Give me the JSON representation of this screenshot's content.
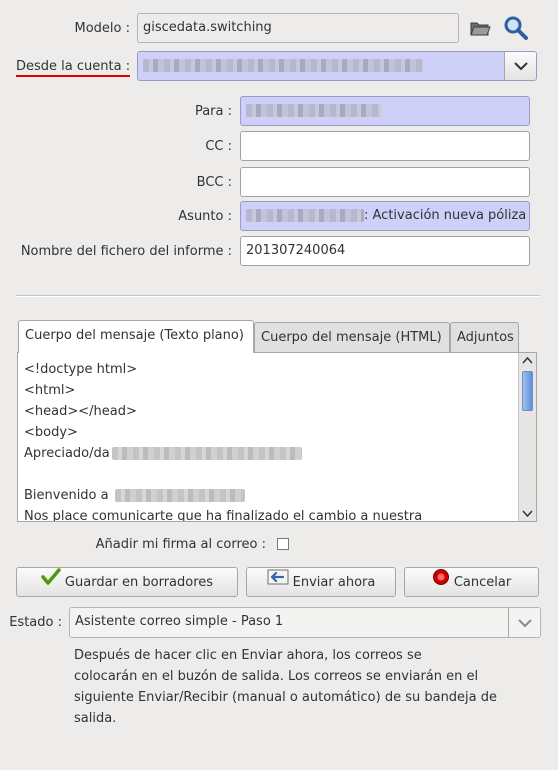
{
  "form": {
    "modelo_label": "Modelo :",
    "modelo_value": "giscedata.switching",
    "desde_label": "Desde la cuenta :",
    "para_label": "Para :",
    "cc_label": "CC :",
    "cc_value": "",
    "bcc_label": "BCC :",
    "bcc_value": "",
    "asunto_label": "Asunto :",
    "asunto_value": ": Activación nueva póliza",
    "fichero_label": "Nombre del fichero del informe :",
    "fichero_value": "201307240064"
  },
  "tabs": [
    {
      "label": "Cuerpo del mensaje (Texto plano)"
    },
    {
      "label": "Cuerpo del mensaje (HTML)"
    },
    {
      "label": "Adjuntos"
    }
  ],
  "body_lines": [
    "<!doctype html>",
    "<html>",
    "<head></head>",
    "<body>",
    "Apreciado/da",
    "",
    "Bienvenido a",
    "Nos place comunicarte que ha finalizado el cambio a nuestra"
  ],
  "signature": {
    "label": "Añadir mi firma al correo :",
    "checked": false
  },
  "buttons": {
    "save": "Guardar en borradores",
    "send": "Enviar ahora",
    "cancel": "Cancelar"
  },
  "estado": {
    "label": "Estado :",
    "value": "Asistente correo simple - Paso 1"
  },
  "help_text": [
    "Después de hacer clic en Enviar ahora, los correos se",
    "colocarán en el buzón de salida. Los correos se enviarán en el",
    "siguiente Enviar/Recibir (manual o automático) de su bandeja de",
    "salida."
  ],
  "colors": {
    "required_field": "#cfd0f7",
    "required_label_underline": "#e00000",
    "window_bg": "#edeceb"
  },
  "icons": {
    "open": "folder-icon",
    "search": "magnifier-icon",
    "dropdown": "chevron-down-icon",
    "save": "check-icon",
    "send": "send-arrow-icon",
    "cancel": "stop-icon"
  }
}
